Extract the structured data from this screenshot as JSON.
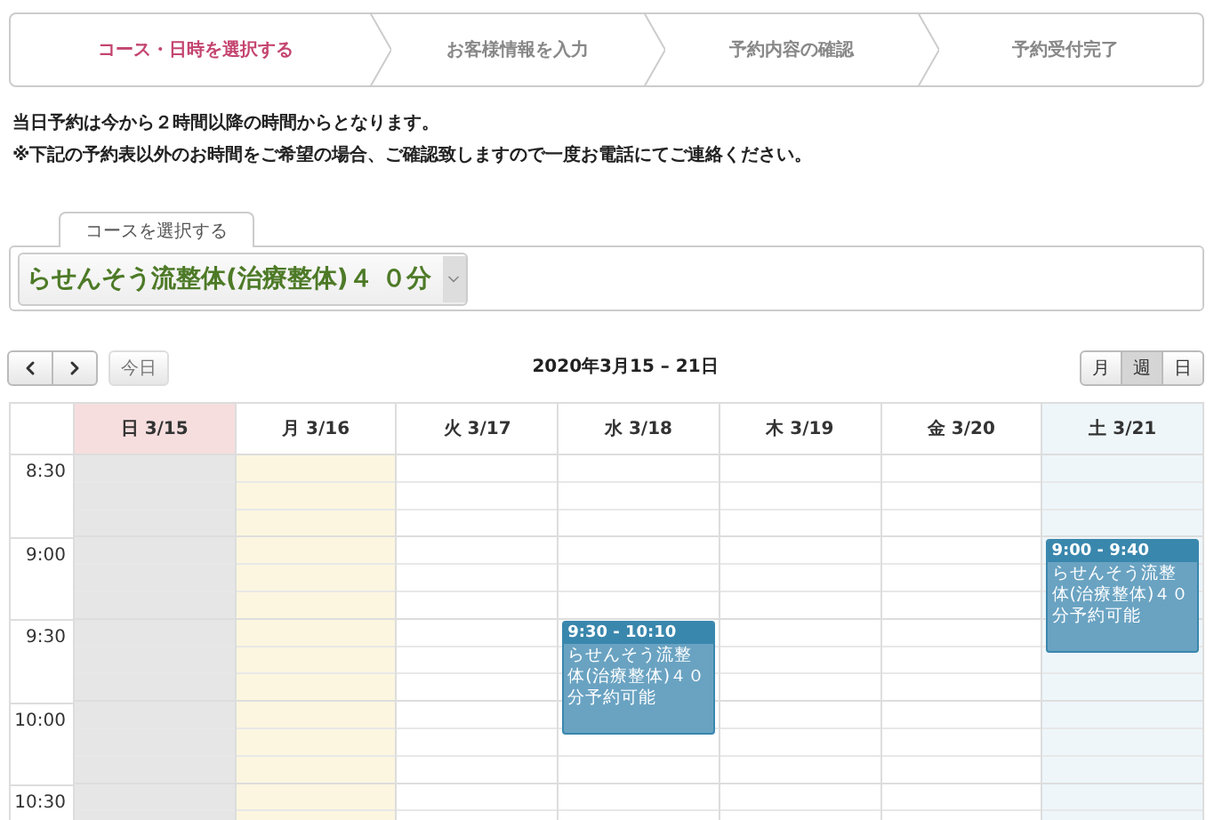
{
  "steps": [
    {
      "label": "コース・日時を選択する",
      "selected": true
    },
    {
      "label": "お客様情報を入力",
      "selected": false
    },
    {
      "label": "予約内容の確認",
      "selected": false
    },
    {
      "label": "予約受付完了",
      "selected": false
    }
  ],
  "notices": [
    "当日予約は今から２時間以降の時間からとなります。",
    "※下記の予約表以外のお時間をご希望の場合、ご確認致しますので一度お電話にてご連絡ください。"
  ],
  "course_tab": {
    "label": "コースを選択する"
  },
  "course_select": {
    "value": "らせんそう流整体(治療整体)４ ０分"
  },
  "calendar": {
    "today_button": {
      "label": "今日",
      "disabled": true
    },
    "title": "2020年3月15 – 21日",
    "views": [
      {
        "label": "月",
        "selected": false
      },
      {
        "label": "週",
        "selected": true
      },
      {
        "label": "日",
        "selected": false
      }
    ],
    "times": [
      "8:30",
      "9:00",
      "9:30",
      "10:00",
      "10:30"
    ],
    "days": [
      {
        "label": "日 3/15",
        "kind": "holiday"
      },
      {
        "label": "月 3/16",
        "kind": "today"
      },
      {
        "label": "火 3/17",
        "kind": "normal"
      },
      {
        "label": "水 3/18",
        "kind": "normal",
        "events": [
          {
            "time": "9:30 - 10:10",
            "title": "らせんそう流整体(治療整体)４０分予約可能"
          }
        ]
      },
      {
        "label": "木 3/19",
        "kind": "normal"
      },
      {
        "label": "金 3/20",
        "kind": "normal"
      },
      {
        "label": "土 3/21",
        "kind": "saturday",
        "events": [
          {
            "time": "9:00 - 9:40",
            "title": "らせんそう流整体(治療整体)４０分予約可能"
          }
        ]
      }
    ]
  }
}
